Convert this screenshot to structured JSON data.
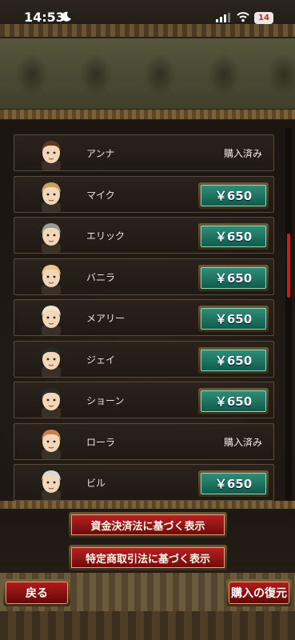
{
  "status_bar": {
    "time": "14:53",
    "battery": "14"
  },
  "colors": {
    "price_button": "#1f7a66",
    "action_button": "#a81818",
    "scrollbar": "#c02020"
  },
  "list": {
    "items": [
      {
        "name": "アンナ",
        "status": "購入済み",
        "price": ""
      },
      {
        "name": "マイク",
        "status": "",
        "price": "￥650"
      },
      {
        "name": "エリック",
        "status": "",
        "price": "￥650"
      },
      {
        "name": "バニラ",
        "status": "",
        "price": "￥650"
      },
      {
        "name": "メアリー",
        "status": "",
        "price": "￥650"
      },
      {
        "name": "ジェイ",
        "status": "",
        "price": "￥650"
      },
      {
        "name": "ショーン",
        "status": "",
        "price": "￥650"
      },
      {
        "name": "ローラ",
        "status": "購入済み",
        "price": ""
      },
      {
        "name": "ビル",
        "status": "",
        "price": "￥650"
      }
    ]
  },
  "legal": {
    "payment_services_label": "資金決済法に基づく表示",
    "commercial_transactions_label": "特定商取引法に基づく表示"
  },
  "footer": {
    "back_label": "戻る",
    "restore_label": "購入の復元"
  }
}
